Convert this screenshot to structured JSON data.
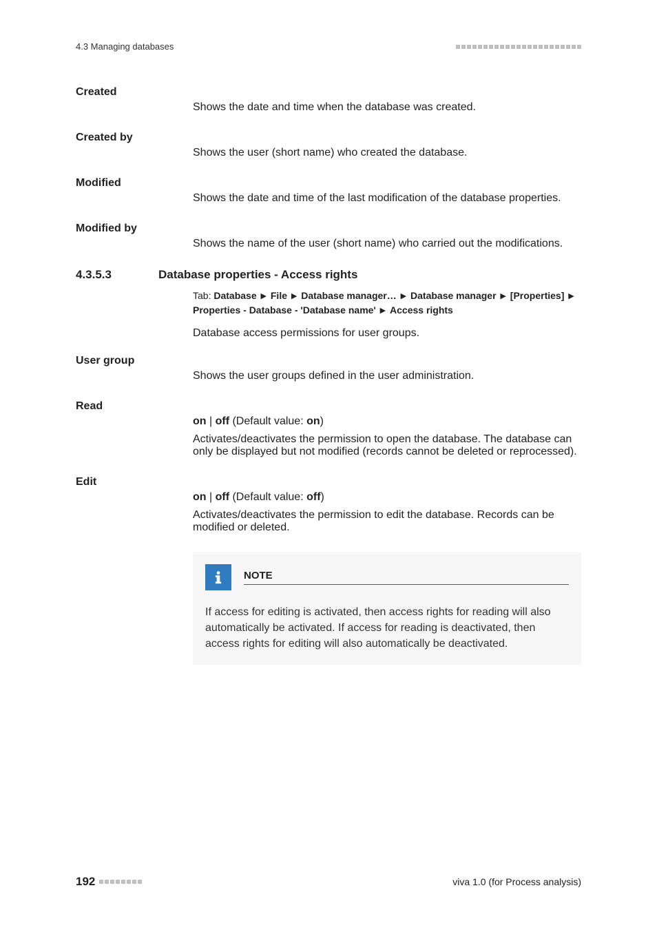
{
  "header": {
    "left": "4.3 Managing databases"
  },
  "fields": {
    "created": {
      "label": "Created",
      "desc": "Shows the date and time when the database was created."
    },
    "created_by": {
      "label": "Created by",
      "desc": "Shows the user (short name) who created the database."
    },
    "modified": {
      "label": "Modified",
      "desc": "Shows the date and time of the last modification of the database properties."
    },
    "modified_by": {
      "label": "Modified by",
      "desc": "Shows the name of the user (short name) who carried out the modifications."
    }
  },
  "section": {
    "num": "4.3.5.3",
    "title": "Database properties - Access rights",
    "tab_label": "Tab: ",
    "tab_parts": {
      "a": "Database",
      "b": "File",
      "c": "Database manager…",
      "d": "Database manager",
      "e": "[Properties]",
      "f": "Properties - Database - 'Database name'",
      "g": "Access rights"
    },
    "intro": "Database access permissions for user groups."
  },
  "user_group": {
    "label": "User group",
    "desc": "Shows the user groups defined in the user administration."
  },
  "read": {
    "label": "Read",
    "on": "on",
    "off": "off",
    "def_prefix": " (Default value: ",
    "def_value": "on",
    "def_suffix": ")",
    "desc": "Activates/deactivates the permission to open the database. The database can only be displayed but not modified (records cannot be deleted or reprocessed)."
  },
  "edit": {
    "label": "Edit",
    "on": "on",
    "off": "off",
    "def_prefix": " (Default value: ",
    "def_value": "off",
    "def_suffix": ")",
    "desc": "Activates/deactivates the permission to edit the database. Records can be modified or deleted."
  },
  "note": {
    "title": "NOTE",
    "body": "If access for editing is activated, then access rights for reading will also automatically be activated. If access for reading is deactivated, then access rights for editing will also automatically be deactivated."
  },
  "footer": {
    "page": "192",
    "right": "viva 1.0 (for Process analysis)"
  },
  "sep": " | "
}
